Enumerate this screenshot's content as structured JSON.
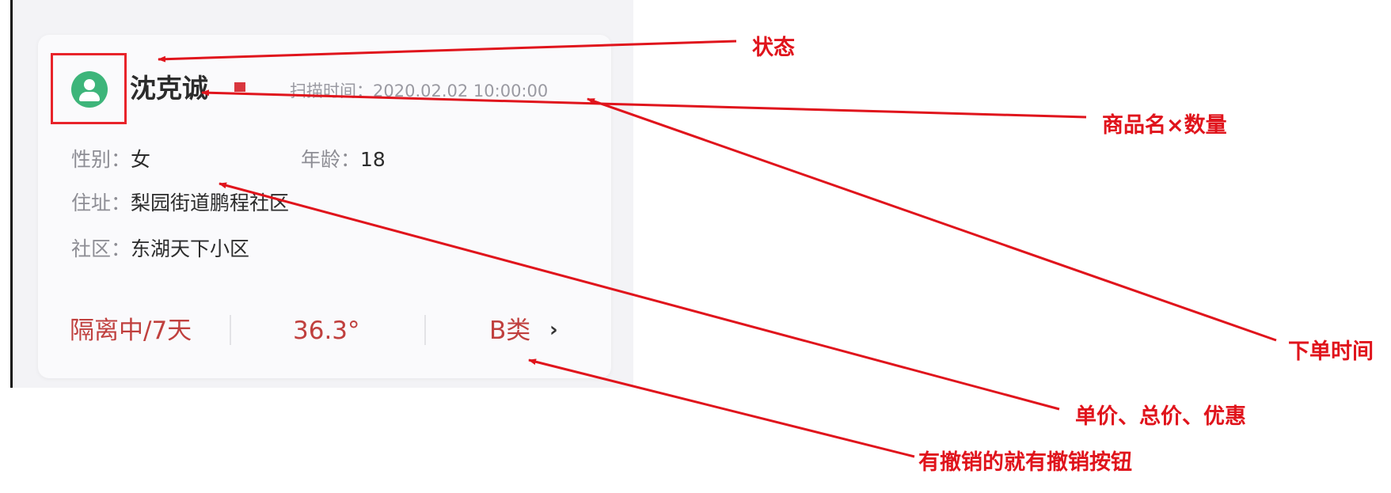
{
  "card": {
    "name": "沈克诚",
    "scan_time": "扫描时间：2020.02.02 10:00:00",
    "gender_label": "性别：",
    "gender_value": "女",
    "age_label": "年龄：",
    "age_value": "18",
    "address_label": "住址：",
    "address_value": "梨园街道鹏程社区",
    "community_label": "社区：",
    "community_value": "东湖天下小区",
    "quarantine": "隔离中/7天",
    "temperature": "36.3°",
    "category": "B类",
    "avatar_icon": "user-avatar-icon",
    "flag_icon": "flag-icon",
    "chevron_icon": "chevron-right-icon"
  },
  "annotations": {
    "status": "状态",
    "product_qty": "商品名×数量",
    "order_time": "下单时间",
    "price": "单价、总价、优惠",
    "cancel": "有撤销的就有撤销按钮"
  },
  "colors": {
    "annotation": "#e0141c",
    "avatar": "#3db57a",
    "accent_text": "#c0403e"
  }
}
